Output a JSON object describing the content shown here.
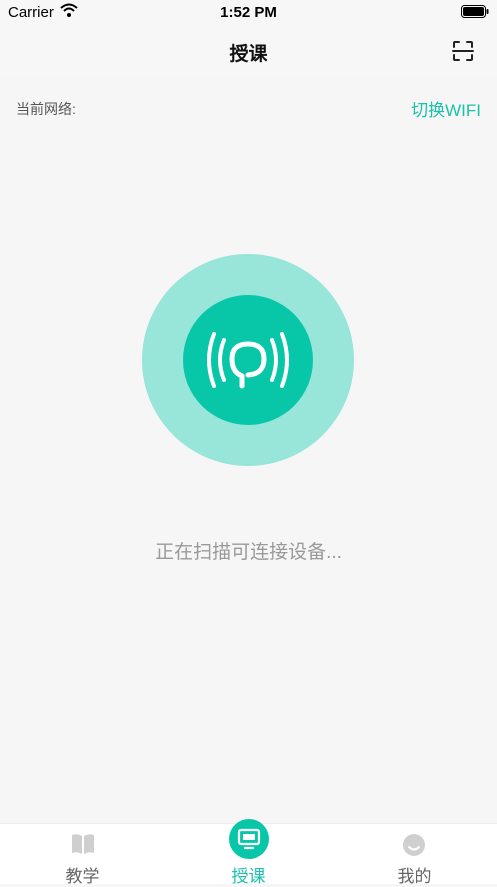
{
  "status_bar": {
    "carrier": "Carrier",
    "time": "1:52 PM"
  },
  "nav": {
    "title": "授课"
  },
  "network": {
    "label": "当前网络:",
    "switch_label": "切换WIFI"
  },
  "scan": {
    "status_text": "正在扫描可连接设备..."
  },
  "tabs": [
    {
      "label": "教学",
      "icon": "book-icon"
    },
    {
      "label": "授课",
      "icon": "screen-cast-icon"
    },
    {
      "label": "我的",
      "icon": "profile-icon"
    }
  ],
  "colors": {
    "accent": "#19c2a8",
    "radar_outer": "#98e5d9",
    "radar_inner": "#07c7a8"
  }
}
